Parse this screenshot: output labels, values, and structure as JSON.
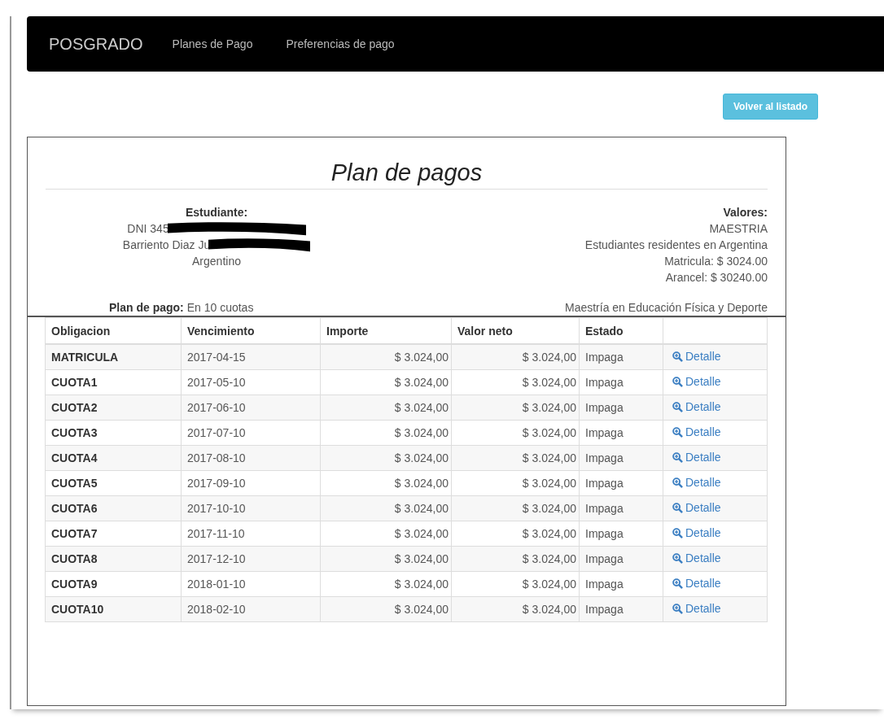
{
  "navbar": {
    "brand": "POSGRADO",
    "links": [
      "Planes de Pago",
      "Preferencias de pago"
    ]
  },
  "back_button": "Volver al listado",
  "card": {
    "title": "Plan de pagos",
    "student": {
      "heading": "Estudiante:",
      "lines": [
        {
          "text": "DNI 345",
          "redacted": true
        },
        {
          "text": "Barriento Diaz Ju",
          "redacted": true
        },
        {
          "text": "Argentino",
          "redacted": false
        }
      ]
    },
    "values": {
      "heading": "Valores:",
      "lines": [
        "MAESTRIA",
        "Estudiantes residentes en Argentina",
        "Matricula: $ 3024.00",
        "Arancel: $ 30240.00"
      ]
    },
    "plan": {
      "label": "Plan de pago:",
      "value": "En 10 cuotas"
    },
    "program": "Maestría en Educación Física y Deporte"
  },
  "table": {
    "columns": [
      "Obligacion",
      "Vencimiento",
      "Importe",
      "Valor neto",
      "Estado"
    ],
    "rows": [
      {
        "obligacion": "MATRICULA",
        "vencimiento": "2017-04-15",
        "importe": "$ 3.024,00",
        "valor_neto": "$ 3.024,00",
        "estado": "Impaga",
        "action": "Detalle"
      },
      {
        "obligacion": "CUOTA1",
        "vencimiento": "2017-05-10",
        "importe": "$ 3.024,00",
        "valor_neto": "$ 3.024,00",
        "estado": "Impaga",
        "action": "Detalle"
      },
      {
        "obligacion": "CUOTA2",
        "vencimiento": "2017-06-10",
        "importe": "$ 3.024,00",
        "valor_neto": "$ 3.024,00",
        "estado": "Impaga",
        "action": "Detalle"
      },
      {
        "obligacion": "CUOTA3",
        "vencimiento": "2017-07-10",
        "importe": "$ 3.024,00",
        "valor_neto": "$ 3.024,00",
        "estado": "Impaga",
        "action": "Detalle"
      },
      {
        "obligacion": "CUOTA4",
        "vencimiento": "2017-08-10",
        "importe": "$ 3.024,00",
        "valor_neto": "$ 3.024,00",
        "estado": "Impaga",
        "action": "Detalle"
      },
      {
        "obligacion": "CUOTA5",
        "vencimiento": "2017-09-10",
        "importe": "$ 3.024,00",
        "valor_neto": "$ 3.024,00",
        "estado": "Impaga",
        "action": "Detalle"
      },
      {
        "obligacion": "CUOTA6",
        "vencimiento": "2017-10-10",
        "importe": "$ 3.024,00",
        "valor_neto": "$ 3.024,00",
        "estado": "Impaga",
        "action": "Detalle"
      },
      {
        "obligacion": "CUOTA7",
        "vencimiento": "2017-11-10",
        "importe": "$ 3.024,00",
        "valor_neto": "$ 3.024,00",
        "estado": "Impaga",
        "action": "Detalle"
      },
      {
        "obligacion": "CUOTA8",
        "vencimiento": "2017-12-10",
        "importe": "$ 3.024,00",
        "valor_neto": "$ 3.024,00",
        "estado": "Impaga",
        "action": "Detalle"
      },
      {
        "obligacion": "CUOTA9",
        "vencimiento": "2018-01-10",
        "importe": "$ 3.024,00",
        "valor_neto": "$ 3.024,00",
        "estado": "Impaga",
        "action": "Detalle"
      },
      {
        "obligacion": "CUOTA10",
        "vencimiento": "2018-02-10",
        "importe": "$ 3.024,00",
        "valor_neto": "$ 3.024,00",
        "estado": "Impaga",
        "action": "Detalle"
      }
    ]
  }
}
